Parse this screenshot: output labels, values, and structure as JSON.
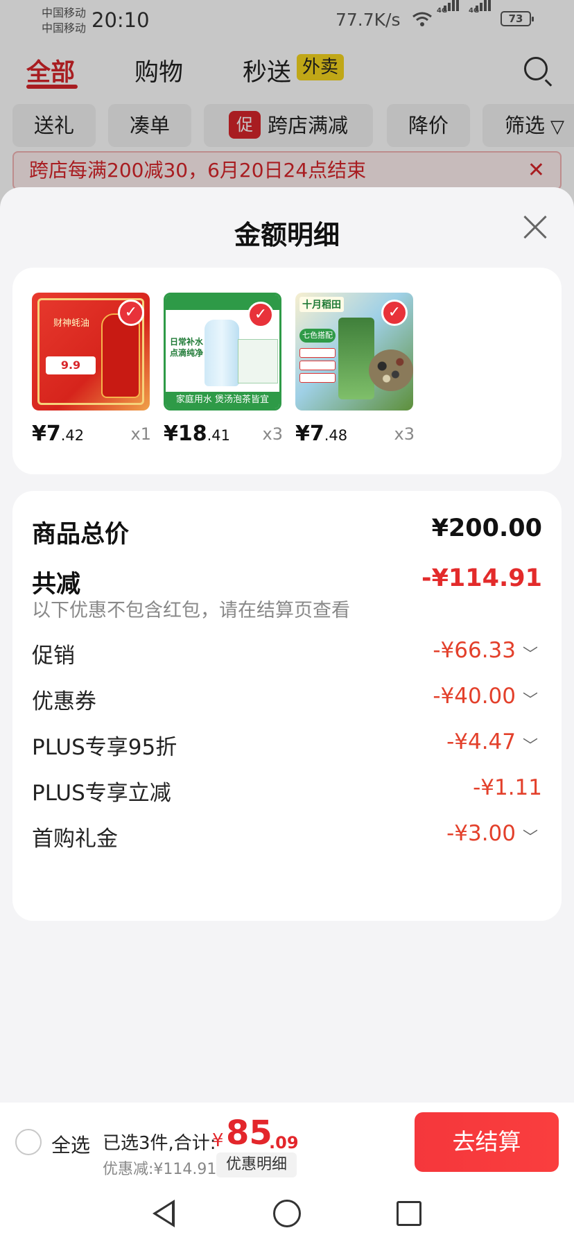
{
  "status_bar": {
    "carrier_1": "中国移动",
    "carrier_2": "中国移动",
    "time": "20:10",
    "net_speed": "77.7K/s",
    "network_1": "4G",
    "network_2": "4G",
    "battery": "73"
  },
  "top_tabs": [
    {
      "label": "全部",
      "active": true
    },
    {
      "label": "购物",
      "active": false
    },
    {
      "label": "秒送",
      "active": false
    }
  ],
  "waimai_badge": "外卖",
  "filter_chips": [
    {
      "label": "送礼"
    },
    {
      "label": "凑单"
    },
    {
      "label": "跨店满减",
      "badge": "促"
    },
    {
      "label": "降价"
    },
    {
      "label": "筛选"
    }
  ],
  "promo_banner": {
    "text": "跨店每满200减30，6月20日24点结束",
    "close": "✕"
  },
  "sheet": {
    "title": "金额明细",
    "products": [
      {
        "price_int": "¥7",
        "price_dec": ".42",
        "qty": "x1",
        "img_text": "财神蚝油",
        "img_price": "9.9"
      },
      {
        "price_int": "¥18",
        "price_dec": ".41",
        "qty": "x3",
        "img_text": "日常补水 点滴纯净",
        "img_footer": "家庭用水 煲汤泡茶皆宜"
      },
      {
        "price_int": "¥7",
        "price_dec": ".48",
        "qty": "x3",
        "img_text": "十月稻田",
        "img_tag": "七色搭配"
      }
    ],
    "summary": {
      "total_label": "商品总价",
      "total_value": "¥200.00",
      "reduce_label": "共减",
      "reduce_value": "-¥114.91",
      "note": "以下优惠不包含红包，请在结算页查看"
    },
    "discounts": [
      {
        "label": "促销",
        "value": "-¥66.33",
        "expandable": true
      },
      {
        "label": "优惠券",
        "value": "-¥40.00",
        "expandable": true
      },
      {
        "label": "PLUS专享95折",
        "value": "-¥4.47",
        "expandable": true
      },
      {
        "label": "PLUS专享立减",
        "value": "-¥1.11",
        "expandable": false
      },
      {
        "label": "首购礼金",
        "value": "-¥3.00",
        "expandable": true
      }
    ]
  },
  "footer": {
    "select_all": "全选",
    "selected_text": "已选3件,合计:",
    "total_symbol": "¥",
    "total_int": "85",
    "total_dec": ".09",
    "discount_text": "优惠减:¥114.91",
    "detail_button": "优惠明细",
    "checkout_button": "去结算"
  },
  "colors": {
    "accent_red": "#e3262b",
    "banner_bg": "#fff0f0",
    "sheet_bg": "#f4f4f6"
  }
}
